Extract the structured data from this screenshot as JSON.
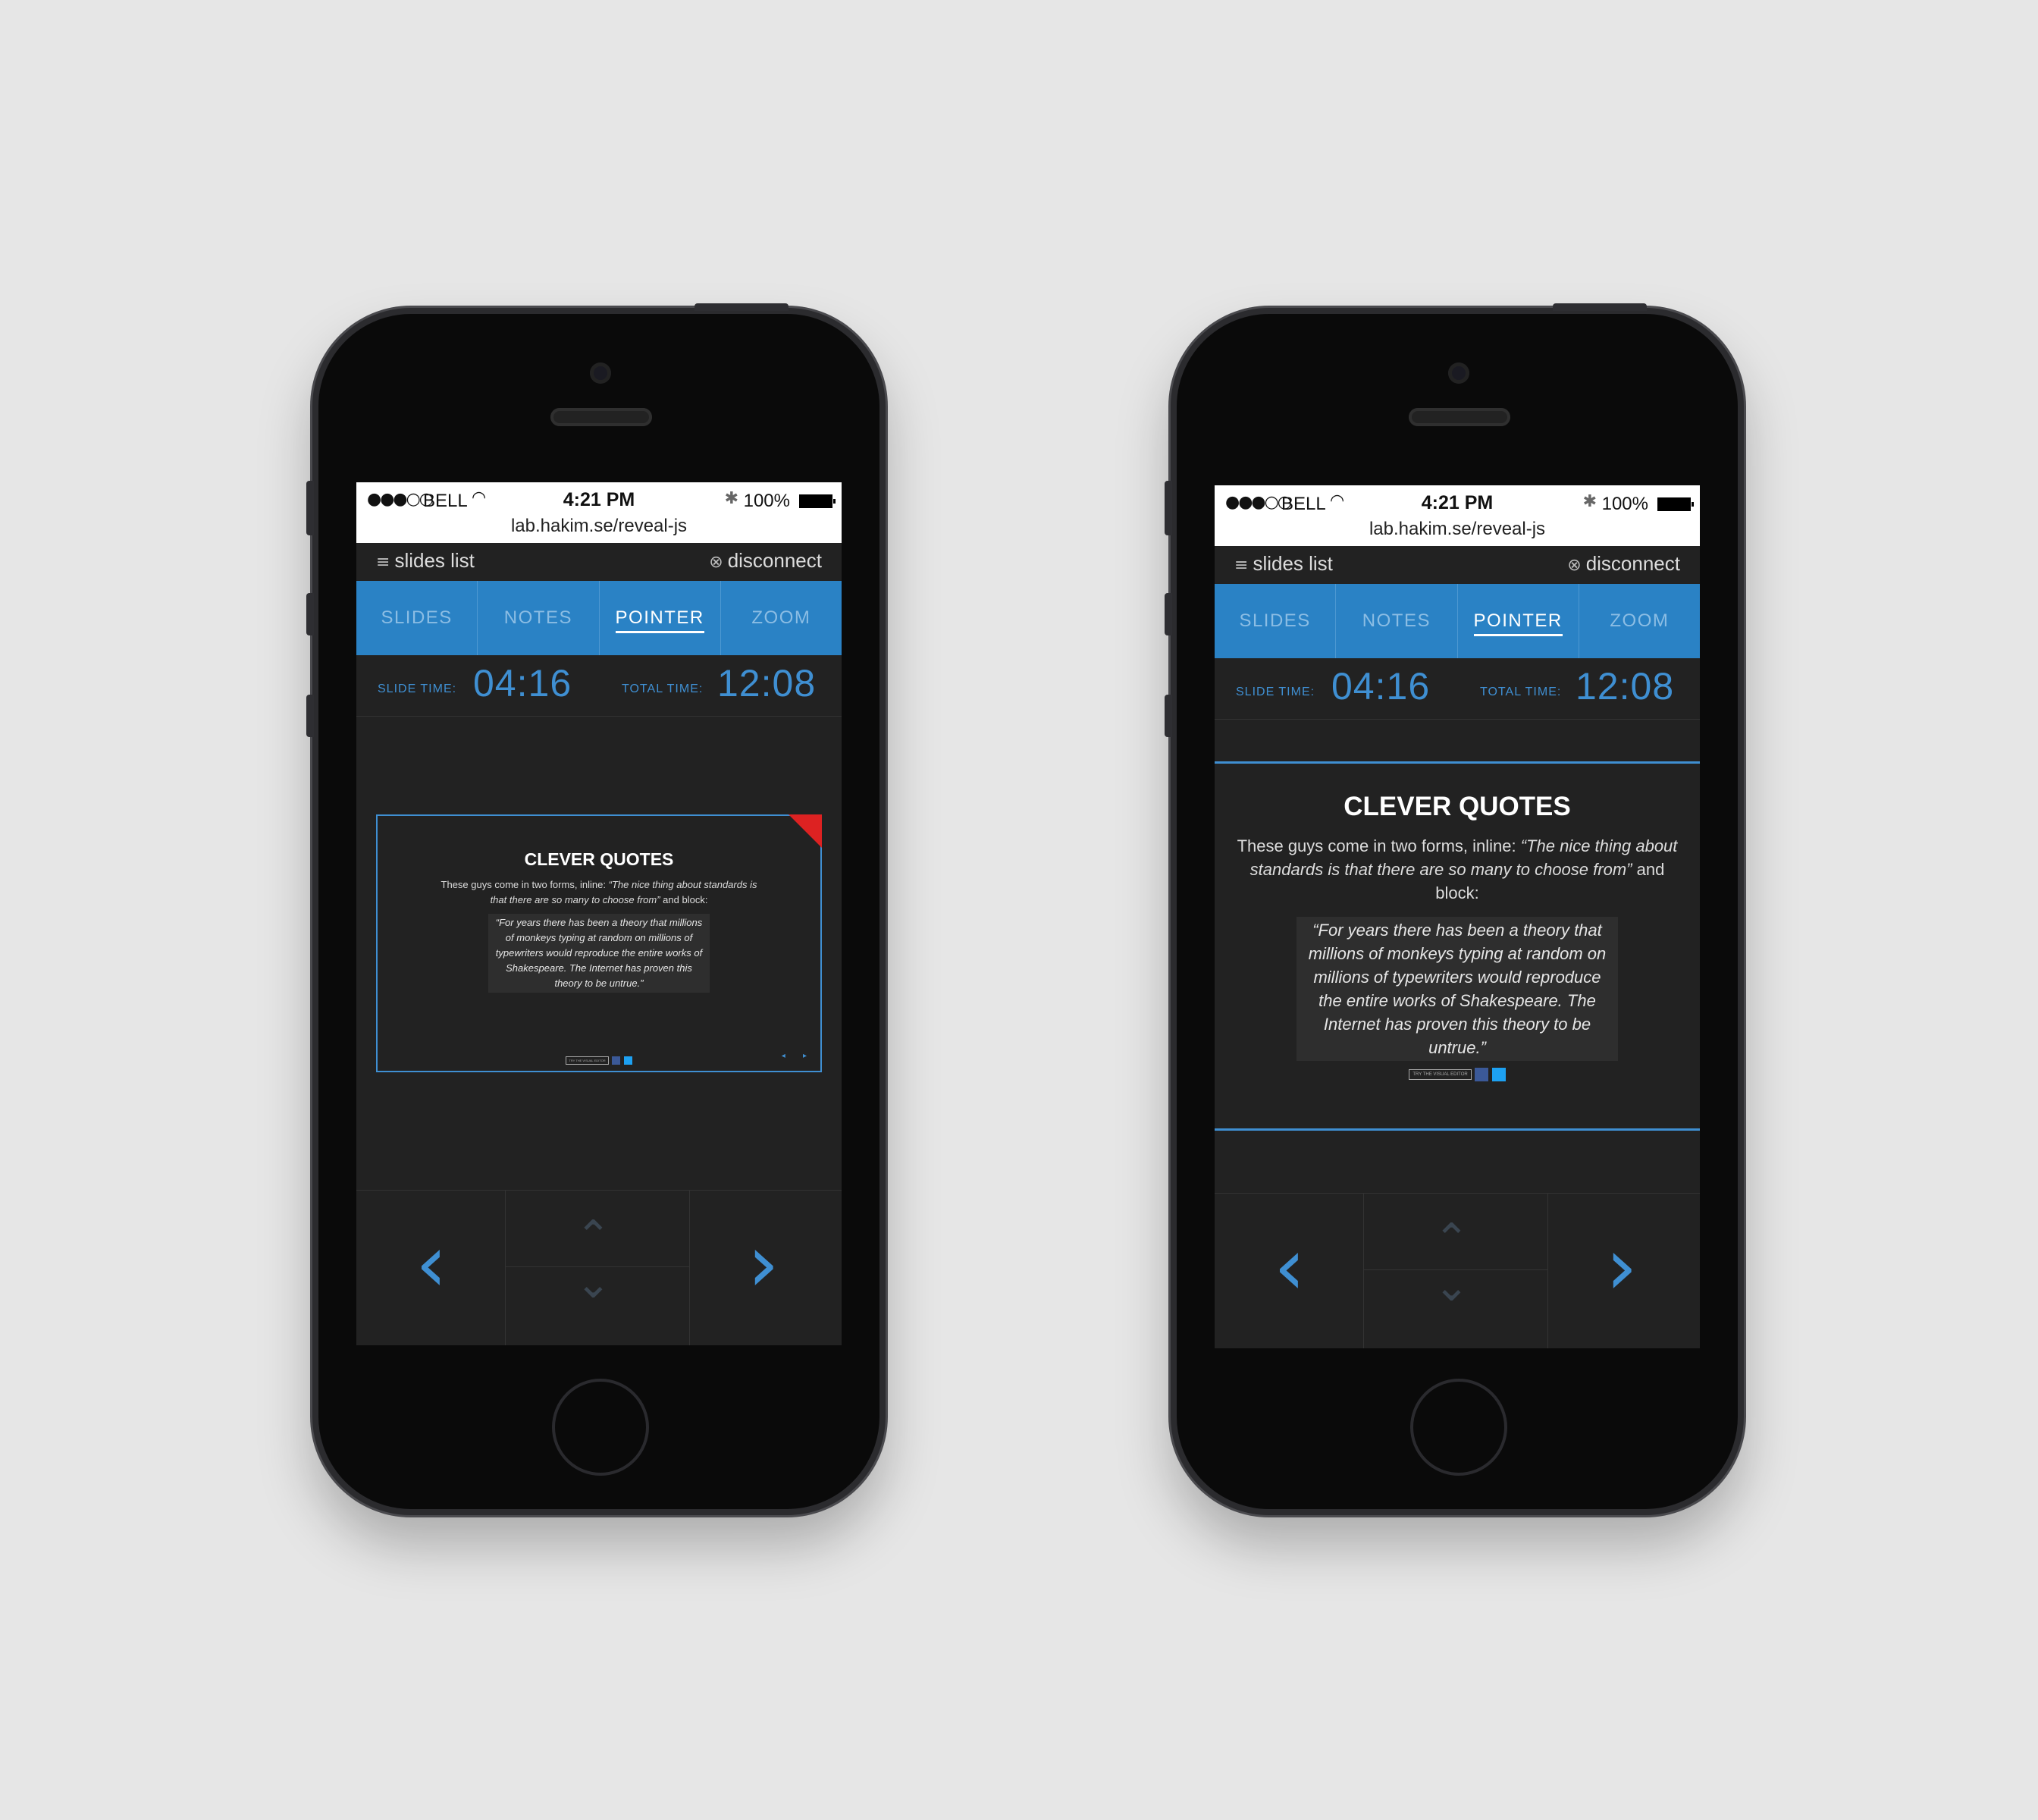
{
  "status_bar": {
    "signal": "●●●○○",
    "carrier": "BELL",
    "wifi_icon": "wifi-icon",
    "time": "4:21 PM",
    "bluetooth": "✱",
    "battery_pct": "100%",
    "url": "lab.hakim.se/reveal-js"
  },
  "topbar": {
    "slides_list": "slides list",
    "disconnect": "disconnect"
  },
  "tabs": [
    {
      "label": "SLIDES"
    },
    {
      "label": "NOTES"
    },
    {
      "label": "POINTER",
      "active": true
    },
    {
      "label": "ZOOM"
    }
  ],
  "timers": {
    "slide_label": "SLIDE TIME:",
    "slide_value": "04:16",
    "total_label": "TOTAL TIME:",
    "total_value": "12:08"
  },
  "slide": {
    "title": "CLEVER QUOTES",
    "body_prefix": "These guys come in two forms, inline: ",
    "body_quote": "“The nice thing about standards is that there are so many to choose from”",
    "body_suffix": " and block:",
    "block_quote": "“For years there has been a theory that millions of monkeys typing at random on millions of typewriters would reproduce the entire works of Shakespeare. The Internet has proven this theory to be untrue.”",
    "footer_button": "TRY THE VISUAL EDITOR",
    "nav_arrows": "◂ ▸"
  },
  "nav": {
    "prev": "‹",
    "next": "›",
    "up": "⌃",
    "down": "⌄"
  },
  "colors": {
    "accent": "#2a82c5",
    "text_blue": "#3f8fd2",
    "background": "#222222"
  }
}
